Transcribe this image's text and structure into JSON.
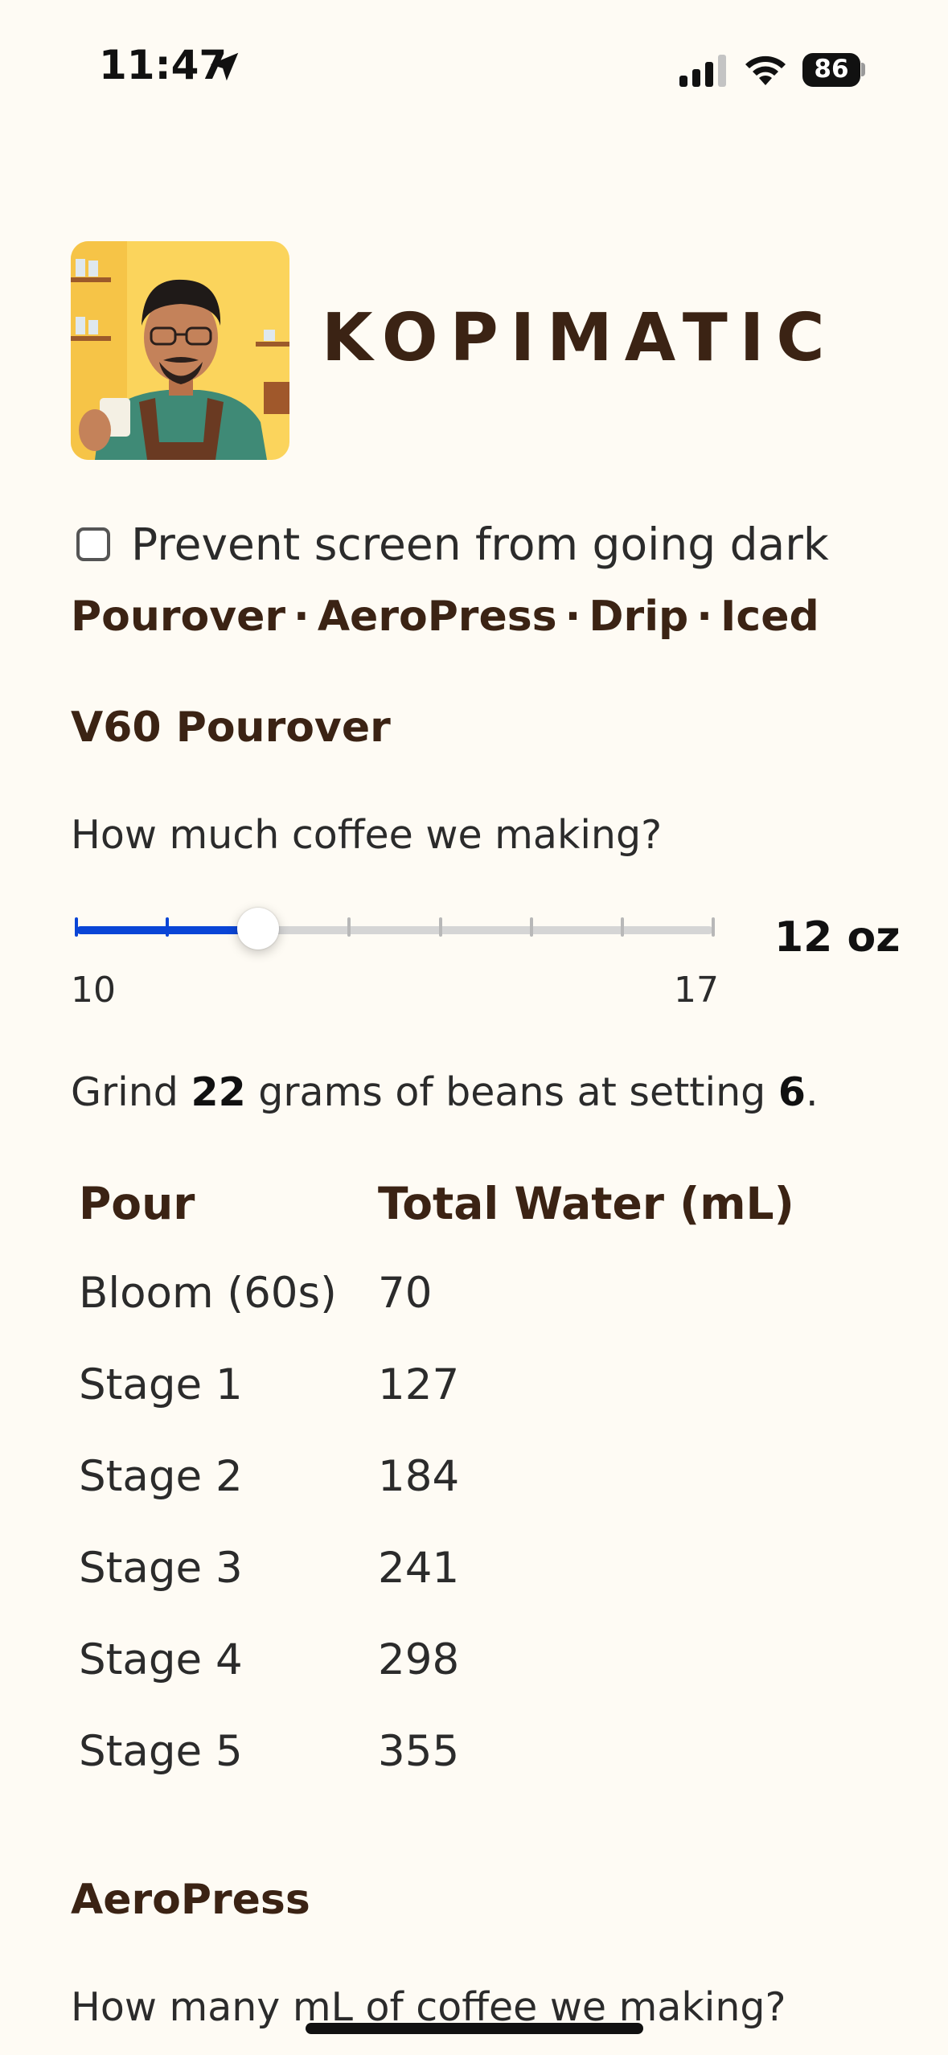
{
  "status_bar": {
    "time": "11:47",
    "battery": "86",
    "location_icon": "location-arrow-icon",
    "signal_icon": "cellular-signal-icon",
    "wifi_icon": "wifi-icon",
    "battery_icon": "battery-icon"
  },
  "header": {
    "brand": "KOPIMATIC",
    "logo_alt": "barista-avatar"
  },
  "settings": {
    "keep_awake_label": "Prevent screen from going dark",
    "keep_awake_checked": false
  },
  "nav": {
    "items": [
      "Pourover",
      "AeroPress",
      "Drip",
      "Iced"
    ],
    "separator": "·"
  },
  "pourover": {
    "title": "V60 Pourover",
    "question": "How much coffee we making?",
    "slider": {
      "min": "10",
      "max": "17",
      "value": 12,
      "value_label": "12 oz"
    },
    "grind": {
      "prefix": "Grind ",
      "grams": "22",
      "middle": " grams of beans at setting ",
      "setting": "6",
      "suffix": "."
    },
    "table": {
      "headers": [
        "Pour",
        "Total Water (mL)"
      ],
      "rows": [
        [
          "Bloom (60s)",
          "70"
        ],
        [
          "Stage 1",
          "127"
        ],
        [
          "Stage 2",
          "184"
        ],
        [
          "Stage 3",
          "241"
        ],
        [
          "Stage 4",
          "298"
        ],
        [
          "Stage 5",
          "355"
        ]
      ]
    }
  },
  "aeropress": {
    "title": "AeroPress",
    "question": "How many mL of coffee we making?"
  },
  "colors": {
    "background": "#fefbf4",
    "heading": "#3b2314",
    "accent": "#0a45d6"
  }
}
